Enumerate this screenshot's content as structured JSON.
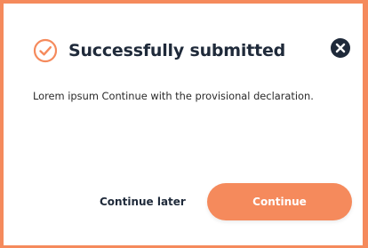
{
  "dialog": {
    "title": "Successfully submitted",
    "message": "Lorem ipsum Continue with the provisional declaration.",
    "icons": {
      "status": "check-circle-icon",
      "close": "close-circle-icon"
    }
  },
  "actions": {
    "secondary_label": "Continue later",
    "primary_label": "Continue"
  },
  "colors": {
    "accent": "#f58a5c",
    "text_dark": "#1f2a3a",
    "close_icon_bg": "#1f2a3a"
  }
}
